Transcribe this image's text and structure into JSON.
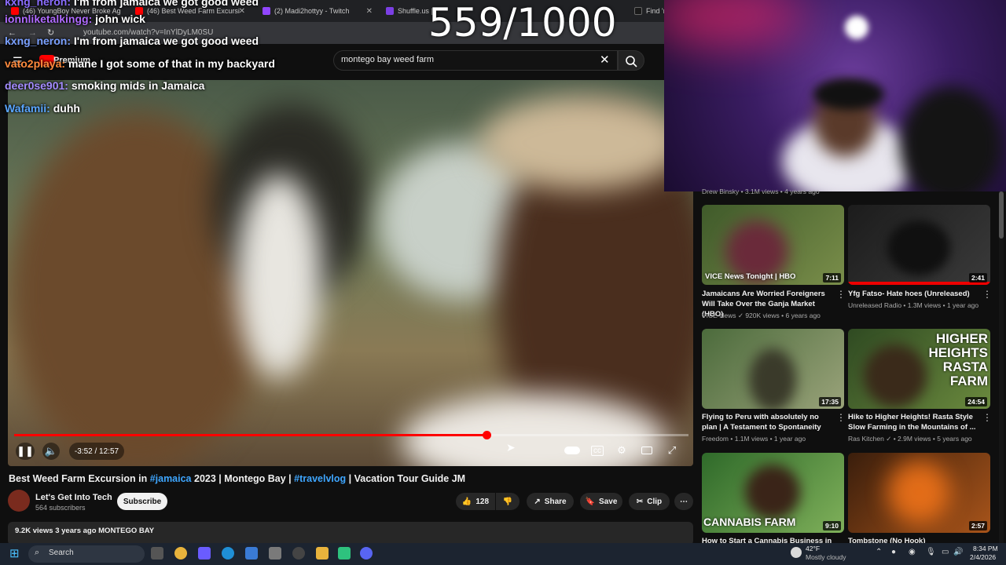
{
  "browser": {
    "tabs": [
      {
        "label": "(46) YoungBoy Never Broke Ag",
        "fav": "#ff0000"
      },
      {
        "label": "(46) Best Weed Farm Excursi",
        "fav": "#ff0000"
      },
      {
        "label": "(2) Madi2hottyy - Twitch",
        "fav": "#9146ff"
      },
      {
        "label": "Shuffle.us |",
        "fav": "#7b3fe4"
      },
      {
        "label": "Find 'n",
        "fav": "#1a1a1a"
      }
    ],
    "url": "youtube.com/watch?v=InYlDyLM0SU"
  },
  "youtube": {
    "search_value": "montego bay weed farm",
    "premium_label": "Premium"
  },
  "counter": "559/1000",
  "chat": [
    {
      "user": "kxng_neron:",
      "msg": "I'm from jamaica we got good weed",
      "color": "#8a6cff"
    },
    {
      "user": "ionnliketalkingg:",
      "msg": "john wick",
      "color": "#b06bff"
    },
    {
      "user": "kxng_neron:",
      "msg": "I'm from jamaica we got good weed",
      "color": "#7aa0ff"
    },
    {
      "user": "vato2playa:",
      "msg": "mane I got some of that in my backyard",
      "color": "#ff8a3d"
    },
    {
      "user": "deer0se901:",
      "msg": "smoking mids in Jamaica",
      "color": "#a48cff"
    },
    {
      "user": "Wafamii:",
      "msg": "duhh",
      "color": "#5aa6ff"
    }
  ],
  "player": {
    "time": "-3:52 / 12:57",
    "progress": 0.7
  },
  "video": {
    "title_parts": [
      {
        "text": "Best Weed Farm Excursion in ",
        "tag": false
      },
      {
        "text": "#jamaica",
        "tag": true
      },
      {
        "text": " 2023 | Montego Bay | ",
        "tag": false
      },
      {
        "text": "#travelvlog",
        "tag": true
      },
      {
        "text": " | Vacation Tour Guide JM",
        "tag": false
      }
    ],
    "channel": "Let's Get Into Tech",
    "subscribers": "564 subscribers",
    "subscribe_label": "Subscribe",
    "likes": "128",
    "share_label": "Share",
    "save_label": "Save",
    "clip_label": "Clip",
    "meta": "9.2K views  3 years ago  MONTEGO BAY"
  },
  "recommendations": [
    {
      "title": "Jamaicans Are Worried Foreigners Will Take Over the Ganja Market (HBO)",
      "channel": "VICE News",
      "stats": "920K views • 6 years ago",
      "duration": "7:11",
      "watermark": "VICE News Tonight | HBO",
      "colors": [
        "#3f5a2a",
        "#7a8e4a"
      ]
    },
    {
      "title": "Yfg Fatso- Hate hoes (Unreleased)",
      "channel": "Unreleased Radio",
      "stats": "1.3M views • 1 year ago",
      "duration": "2:41",
      "watermark": "",
      "colors": [
        "#1c1c1c",
        "#3a3a3a"
      ]
    },
    {
      "title": "Flying to Peru with absolutely no plan | A Testament to Spontaneity",
      "channel": "Freedom",
      "stats": "1.1M views • 1 year ago",
      "duration": "17:35",
      "watermark": "",
      "colors": [
        "#4c6b3c",
        "#9aa37a"
      ]
    },
    {
      "title": "Hike to Higher Heights! Rasta Style Slow Farming in the Mountains of ...",
      "channel": "Ras Kitchen",
      "stats": "2.9M views • 5 years ago",
      "duration": "24:54",
      "watermark": "HIGHER HEIGHTS RASTA FARM",
      "colors": [
        "#2f4a22",
        "#6b8a3e"
      ]
    },
    {
      "title": "How to Start a Cannabis Business in ...",
      "channel": "",
      "stats": "",
      "duration": "9:10",
      "watermark": "CANNABIS FARM",
      "colors": [
        "#2f6a2a",
        "#7fb05a"
      ]
    },
    {
      "title": "Tombstone (No Hook)",
      "channel": "",
      "stats": "",
      "duration": "2:57",
      "watermark": "",
      "colors": [
        "#3a1e0c",
        "#a8541a"
      ]
    }
  ],
  "sidebar_partial": "Drew Binsky • 3.1M views • 4 years ago",
  "taskbar": {
    "search_label": "Search",
    "weather_temp": "42°F",
    "weather_desc": "Mostly cloudy",
    "time": "8:34 PM",
    "date": "2/4/2026"
  }
}
